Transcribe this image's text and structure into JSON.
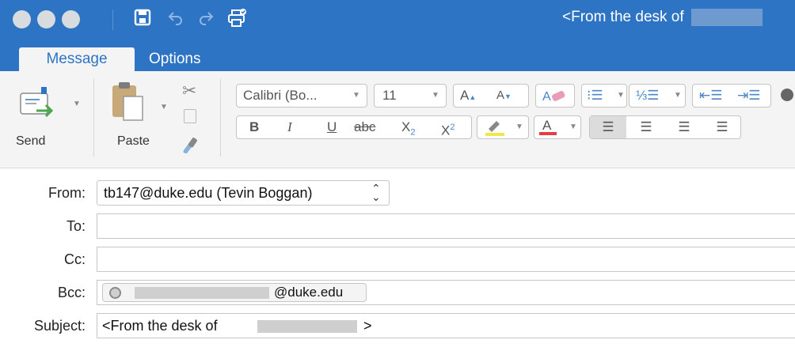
{
  "window": {
    "title_prefix": "<From the desk of",
    "traffic_lights": [
      "close",
      "minimize",
      "zoom"
    ],
    "toolbar_icons": [
      "save-icon",
      "undo-icon",
      "redo-icon",
      "printer-icon"
    ]
  },
  "tabs": [
    {
      "label": "Message",
      "active": true
    },
    {
      "label": "Options",
      "active": false
    }
  ],
  "ribbon": {
    "send_label": "Send",
    "paste_label": "Paste",
    "font_name": "Calibri (Bo...",
    "font_size": "11",
    "bold": "B",
    "italic": "I",
    "underline": "U",
    "strikethrough": "abc",
    "subscript": "X",
    "subscript_mark": "2",
    "superscript": "X",
    "superscript_mark": "2",
    "grow_font": "A",
    "shrink_font": "A",
    "font_color": "A",
    "highlight_color": "#f2e64f",
    "font_color_bar": "#e63c46"
  },
  "fields": {
    "from_label": "From:",
    "from_value": "tb147@duke.edu (Tevin Boggan)",
    "to_label": "To:",
    "to_value": "",
    "cc_label": "Cc:",
    "cc_value": "",
    "bcc_label": "Bcc:",
    "bcc_chip_suffix": "@duke.edu",
    "subject_label": "Subject:",
    "subject_prefix": "<From the desk of",
    "subject_suffix": ">"
  },
  "colors": {
    "accent": "#2e74c4",
    "ribbon_bg": "#f4f4f4"
  }
}
